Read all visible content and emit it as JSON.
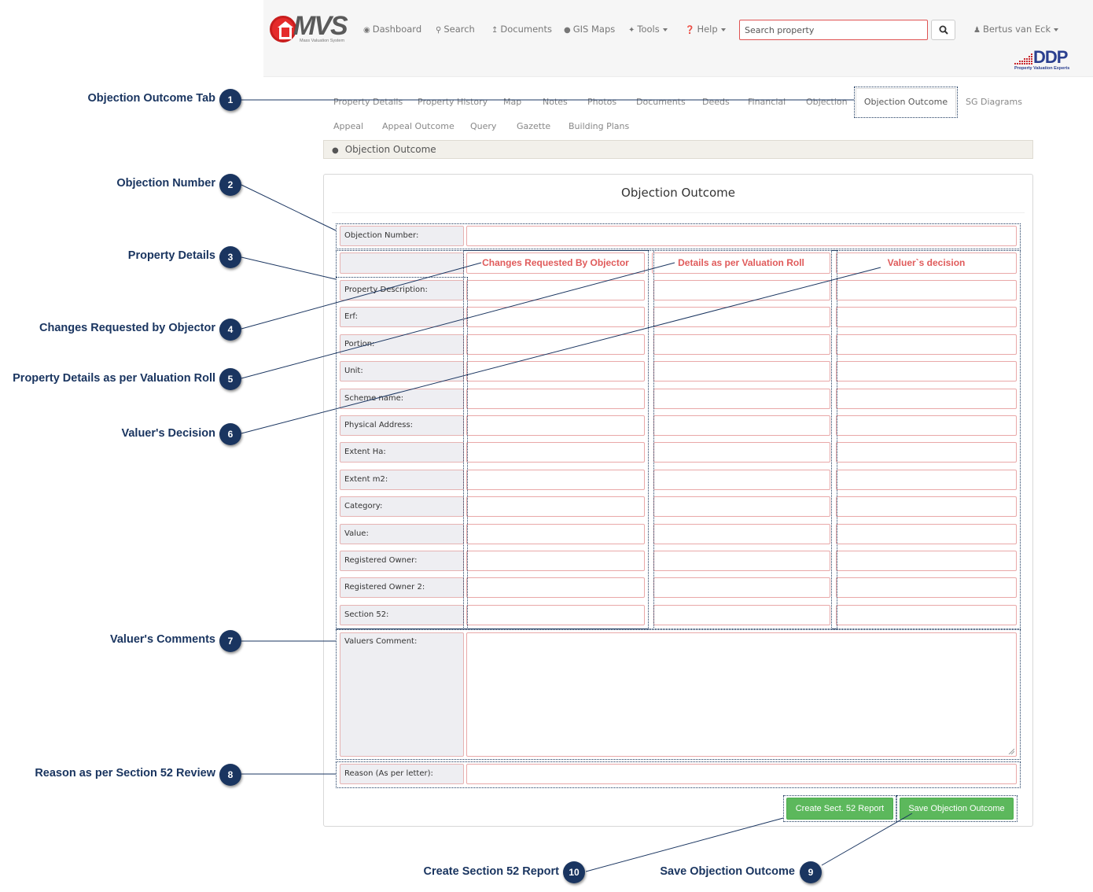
{
  "header": {
    "logo_text": "MVS",
    "logo_subtitle": "Mass Valuation System",
    "nav": [
      {
        "label": "Dashboard",
        "icon": "dashboard-icon"
      },
      {
        "label": "Search",
        "icon": "search-icon"
      },
      {
        "label": "Documents",
        "icon": "upload-icon"
      },
      {
        "label": "GIS Maps",
        "icon": "globe-icon"
      },
      {
        "label": "Tools",
        "icon": "wrench-icon"
      },
      {
        "label": "Help",
        "icon": "question-icon"
      }
    ],
    "search_placeholder": "Search property",
    "user": "Bertus van Eck",
    "brand": "DDP",
    "brand_subtitle": "Property Valuation Experts"
  },
  "tabs": {
    "row1": [
      "Property Details",
      "Property History",
      "Map",
      "Notes",
      "Photos",
      "Documents",
      "Deeds",
      "Financial",
      "Objection",
      "Objection Outcome",
      "SG Diagrams"
    ],
    "row2": [
      "Appeal",
      "Appeal Outcome",
      "Query",
      "Gazette",
      "Building Plans"
    ],
    "active": "Objection Outcome"
  },
  "breadcrumb": "Objection Outcome",
  "form": {
    "title": "Objection Outcome",
    "objection_number_label": "Objection Number:",
    "columns": [
      "Changes Requested By Objector",
      "Details as per Valuation Roll",
      "Valuer`s decision"
    ],
    "rows": [
      "Property Description:",
      "Erf:",
      "Portion:",
      "Unit:",
      "Scheme name:",
      "Physical Address:",
      "Extent Ha:",
      "Extent m2:",
      "Category:",
      "Value:",
      "Registered Owner:",
      "Registered Owner 2:",
      "Section 52:"
    ],
    "comment_label": "Valuers Comment:",
    "reason_label": "Reason (As per letter):",
    "create_button": "Create Sect. 52 Report",
    "save_button": "Save Objection Outcome"
  },
  "annotations": [
    {
      "num": "1",
      "label": "Objection Outcome Tab"
    },
    {
      "num": "2",
      "label": "Objection Number"
    },
    {
      "num": "3",
      "label": "Property Details"
    },
    {
      "num": "4",
      "label": "Changes Requested by Objector"
    },
    {
      "num": "5",
      "label": "Property Details as per Valuation Roll"
    },
    {
      "num": "6",
      "label": "Valuer's Decision"
    },
    {
      "num": "7",
      "label": "Valuer's Comments"
    },
    {
      "num": "8",
      "label": "Reason as per Section 52 Review"
    },
    {
      "num": "9",
      "label": "Save Objection Outcome"
    },
    {
      "num": "10",
      "label": "Create Section 52 Report"
    }
  ],
  "colors": {
    "annotation": "#1a3560",
    "required_border": "#e9a8a8",
    "column_header_text": "#e05b5b",
    "button_green": "#5cb85c"
  }
}
